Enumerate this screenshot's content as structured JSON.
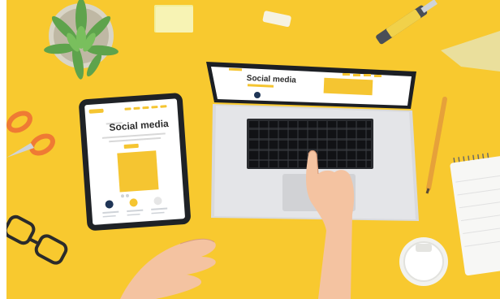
{
  "scene": {
    "background_color": "#f8c92f",
    "accent_color": "#f5c531",
    "objects": [
      "potted-plant",
      "sticky-notes",
      "eraser",
      "utility-knife",
      "ruler",
      "pencil",
      "notepad",
      "scissors",
      "eyeglasses",
      "coffee-cup-lid",
      "tablet",
      "laptop",
      "hand"
    ]
  },
  "tablet_screen": {
    "heading": "Social media"
  },
  "laptop_screen": {
    "heading": "Social media"
  }
}
